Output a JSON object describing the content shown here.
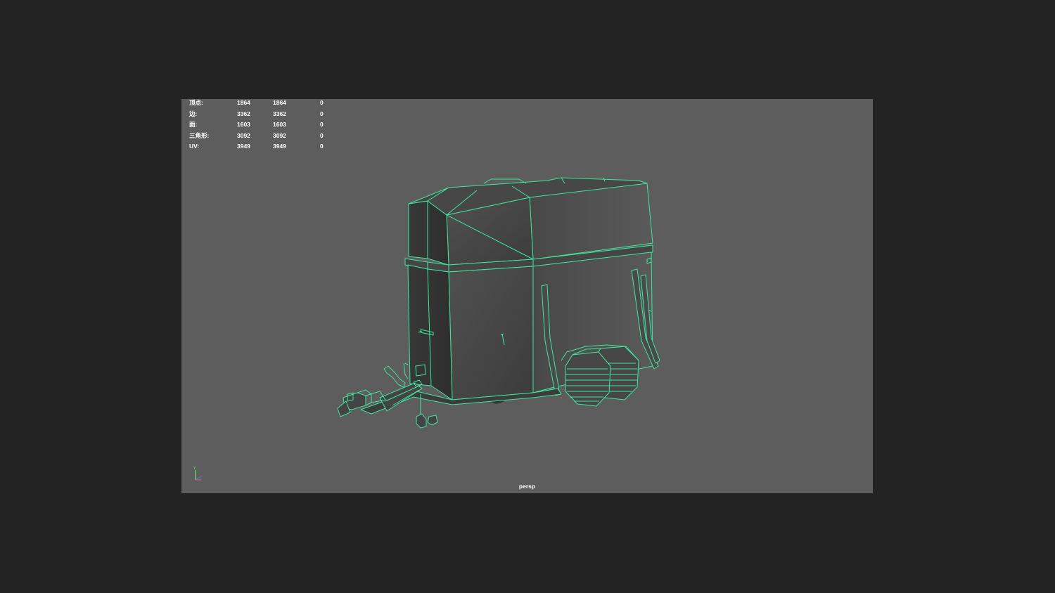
{
  "hud": {
    "rows": [
      {
        "label": "顶点:",
        "a": "1864",
        "b": "1864",
        "c": "0"
      },
      {
        "label": "边:",
        "a": "3362",
        "b": "3362",
        "c": "0"
      },
      {
        "label": "面:",
        "a": "1603",
        "b": "1603",
        "c": "0"
      },
      {
        "label": "三角形:",
        "a": "3092",
        "b": "3092",
        "c": "0"
      },
      {
        "label": "UV:",
        "a": "3949",
        "b": "3949",
        "c": "0"
      }
    ]
  },
  "viewport": {
    "camera": "persp",
    "background_color": "#5d5d5d",
    "wire_color": "#3fe6a0"
  },
  "gizmo": {
    "y_label": "Y",
    "z_label": "Z"
  }
}
